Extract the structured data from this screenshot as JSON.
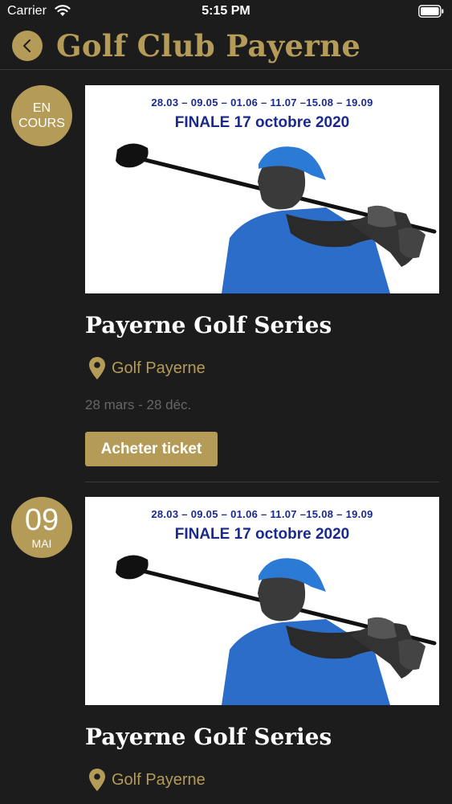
{
  "status_bar": {
    "carrier": "Carrier",
    "time": "5:15 PM"
  },
  "header": {
    "title": "Golf Club Payerne"
  },
  "events": [
    {
      "badge_line1": "EN",
      "badge_line2": "COURS",
      "poster_dates": "28.03 – 09.05 – 01.06 – 11.07 –15.08 – 19.09",
      "poster_finale": "FINALE 17 octobre 2020",
      "title": "Payerne Golf Series",
      "location": "Golf Payerne",
      "date_range": "28 mars - 28 déc.",
      "buy_label": "Acheter ticket"
    },
    {
      "badge_day": "09",
      "badge_month": "MAI",
      "poster_dates": "28.03 – 09.05 – 01.06 – 11.07 –15.08 – 19.09",
      "poster_finale": "FINALE 17 octobre 2020",
      "title": "Payerne Golf Series",
      "location": "Golf Payerne"
    }
  ],
  "colors": {
    "accent": "#b59b58",
    "background": "#1c1c1c",
    "poster_text": "#1a2a8c"
  },
  "icons": {
    "back": "chevron-left-icon",
    "location": "map-pin-icon"
  }
}
